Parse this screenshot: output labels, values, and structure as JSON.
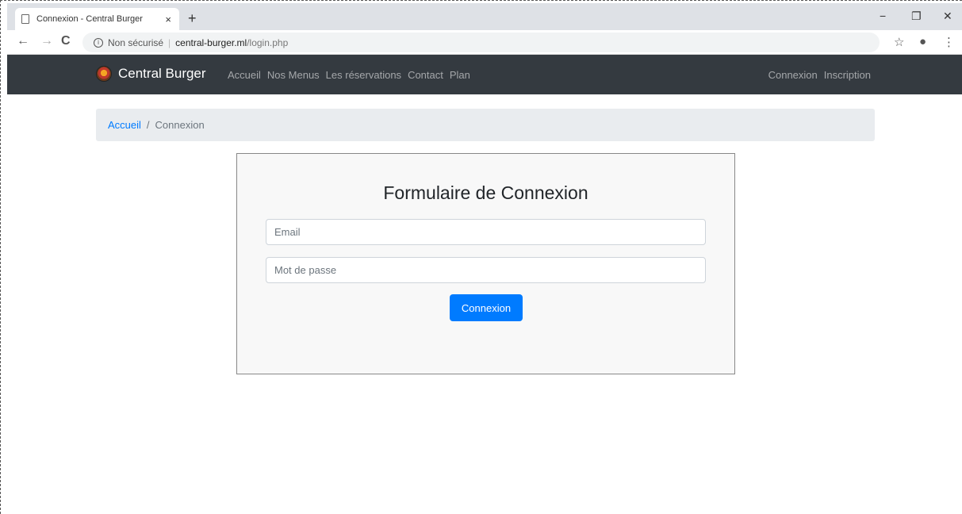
{
  "browser": {
    "tab_title": "Connexion - Central Burger",
    "tab_close": "×",
    "new_tab": "+",
    "minimize": "−",
    "restore": "❐",
    "close": "✕",
    "back": "←",
    "forward": "→",
    "reload": "C",
    "info_glyph": "i",
    "security_label": "Non sécurisé",
    "separator": "|",
    "url_host": "central-burger.ml",
    "url_path": "/login.php",
    "star": "☆",
    "profile": "●",
    "menu": "⋮"
  },
  "navbar": {
    "brand": "Central Burger",
    "links": [
      "Accueil",
      "Nos Menus",
      "Les réservations",
      "Contact",
      "Plan"
    ],
    "right_links": [
      "Connexion",
      "Inscription"
    ]
  },
  "breadcrumb": {
    "home": "Accueil",
    "separator": "/",
    "current": "Connexion"
  },
  "login_form": {
    "title": "Formulaire de Connexion",
    "email_placeholder": "Email",
    "password_placeholder": "Mot de passe",
    "submit_label": "Connexion"
  },
  "colors": {
    "navbar_bg": "#343a40",
    "link_blue": "#007bff",
    "button_blue": "#007bff",
    "breadcrumb_bg": "#e9ecef"
  }
}
